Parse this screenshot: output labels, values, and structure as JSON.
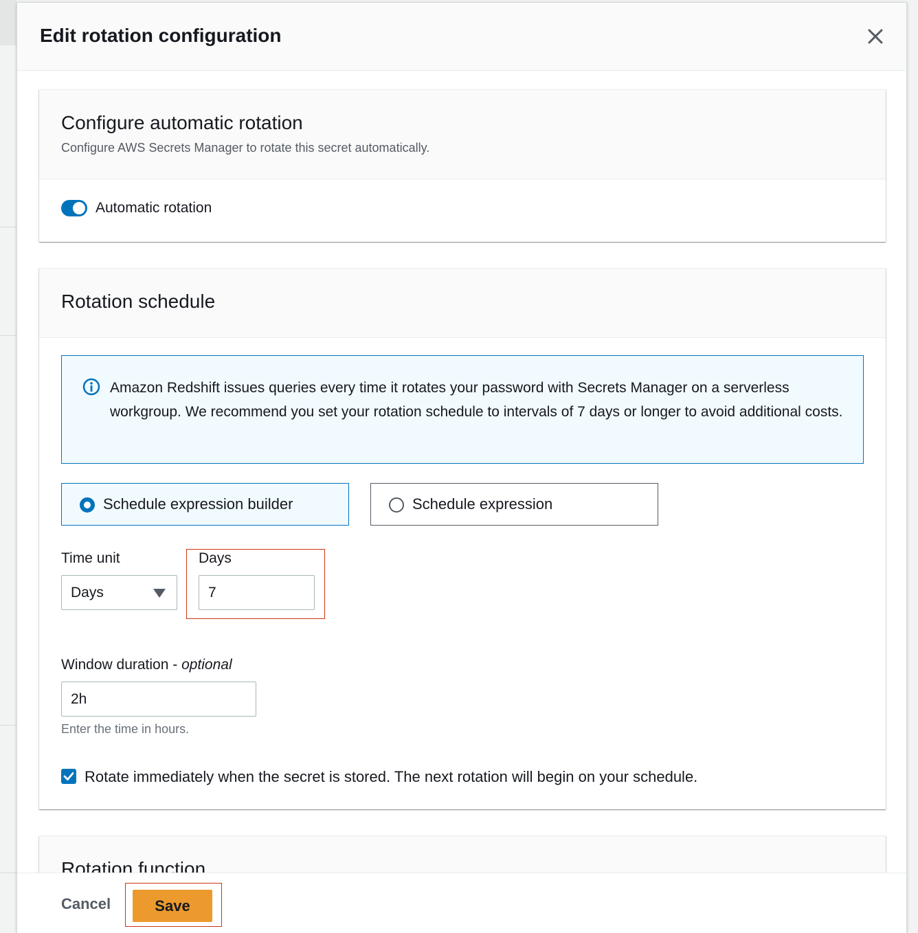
{
  "modal": {
    "title": "Edit rotation configuration"
  },
  "auto_rotation": {
    "title": "Configure automatic rotation",
    "description": "Configure AWS Secrets Manager to rotate this secret automatically.",
    "toggle_label": "Automatic rotation",
    "toggle_on": true
  },
  "schedule": {
    "title": "Rotation schedule",
    "alert_text": "Amazon Redshift issues queries every time it rotates your password with Secrets Manager on a serverless workgroup. We recommend you set your rotation schedule to intervals of 7 days or longer to avoid additional costs.",
    "options": [
      {
        "label": "Schedule expression builder",
        "selected": true
      },
      {
        "label": "Schedule expression",
        "selected": false
      }
    ],
    "time_unit_label": "Time unit",
    "time_unit_value": "Days",
    "days_label": "Days",
    "days_value": "7",
    "window_label": "Window duration - ",
    "window_optional": "optional",
    "window_value": "2h",
    "window_hint": "Enter the time in hours.",
    "rotate_immediately_label": "Rotate immediately when the secret is stored. The next rotation will begin on your schedule.",
    "rotate_immediately_checked": true
  },
  "function": {
    "title": "Rotation function"
  },
  "footer": {
    "cancel_label": "Cancel",
    "save_label": "Save"
  },
  "colors": {
    "primary": "#0073bb",
    "save": "#ec9a2e",
    "highlight": "#d13212"
  }
}
